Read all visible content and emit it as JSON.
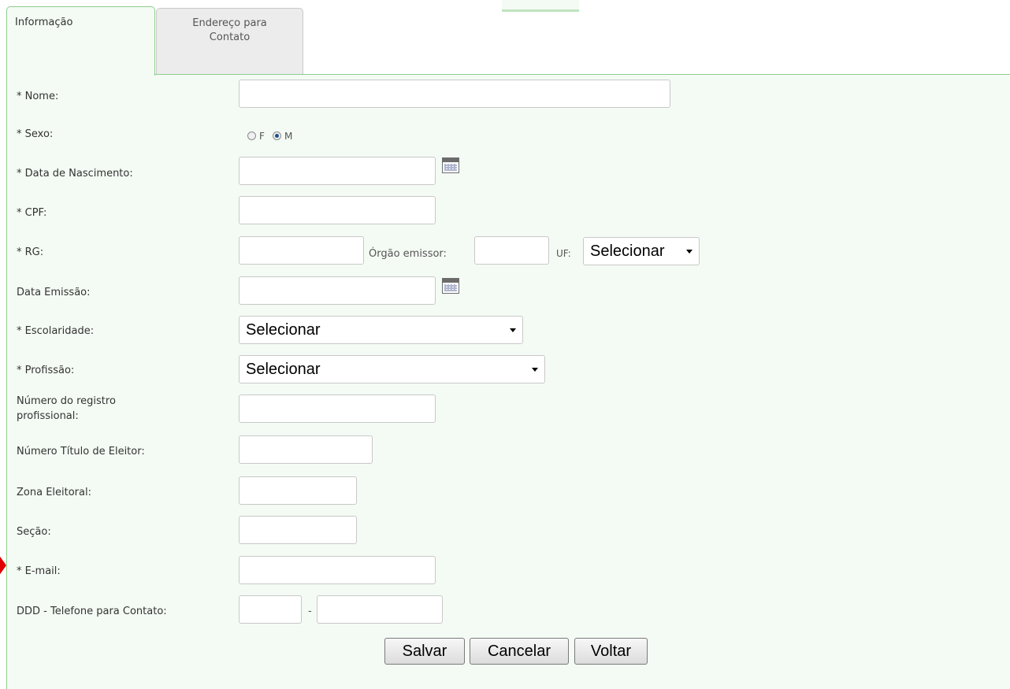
{
  "tabs": {
    "info_label": "Informação",
    "address_label": "Endereço para Contato"
  },
  "form": {
    "nome_label": "* Nome:",
    "sexo_label": "* Sexo:",
    "sexo_f": "F",
    "sexo_m": "M",
    "sexo_selected": "M",
    "nascimento_label": "* Data de Nascimento:",
    "cpf_label": "* CPF:",
    "rg_label": "* RG:",
    "orgao_label": "Órgão emissor:",
    "uf_label": "UF:",
    "uf_value": "Selecionar",
    "data_emissao_label": "Data Emissão:",
    "escolaridade_label": "* Escolaridade:",
    "escolaridade_value": "Selecionar",
    "profissao_label": "* Profissão:",
    "profissao_value": "Selecionar",
    "registro_label": "Número do registro profissional:",
    "titulo_label": "Número Título de Eleitor:",
    "zona_label": "Zona Eleitoral:",
    "secao_label": "Seção:",
    "email_label": "* E-mail:",
    "telefone_label": "DDD - Telefone para Contato:",
    "phone_separator": "-"
  },
  "buttons": {
    "salvar": "Salvar",
    "cancelar": "Cancelar",
    "voltar": "Voltar"
  },
  "icons": {
    "calendar": "calendar-icon",
    "dropdown": "chevron-down-icon",
    "marker": "red-arrow-marker"
  },
  "colors": {
    "panel_bg": "#f4fbf4",
    "panel_border": "#8fcc8f",
    "marker": "#e00000"
  }
}
